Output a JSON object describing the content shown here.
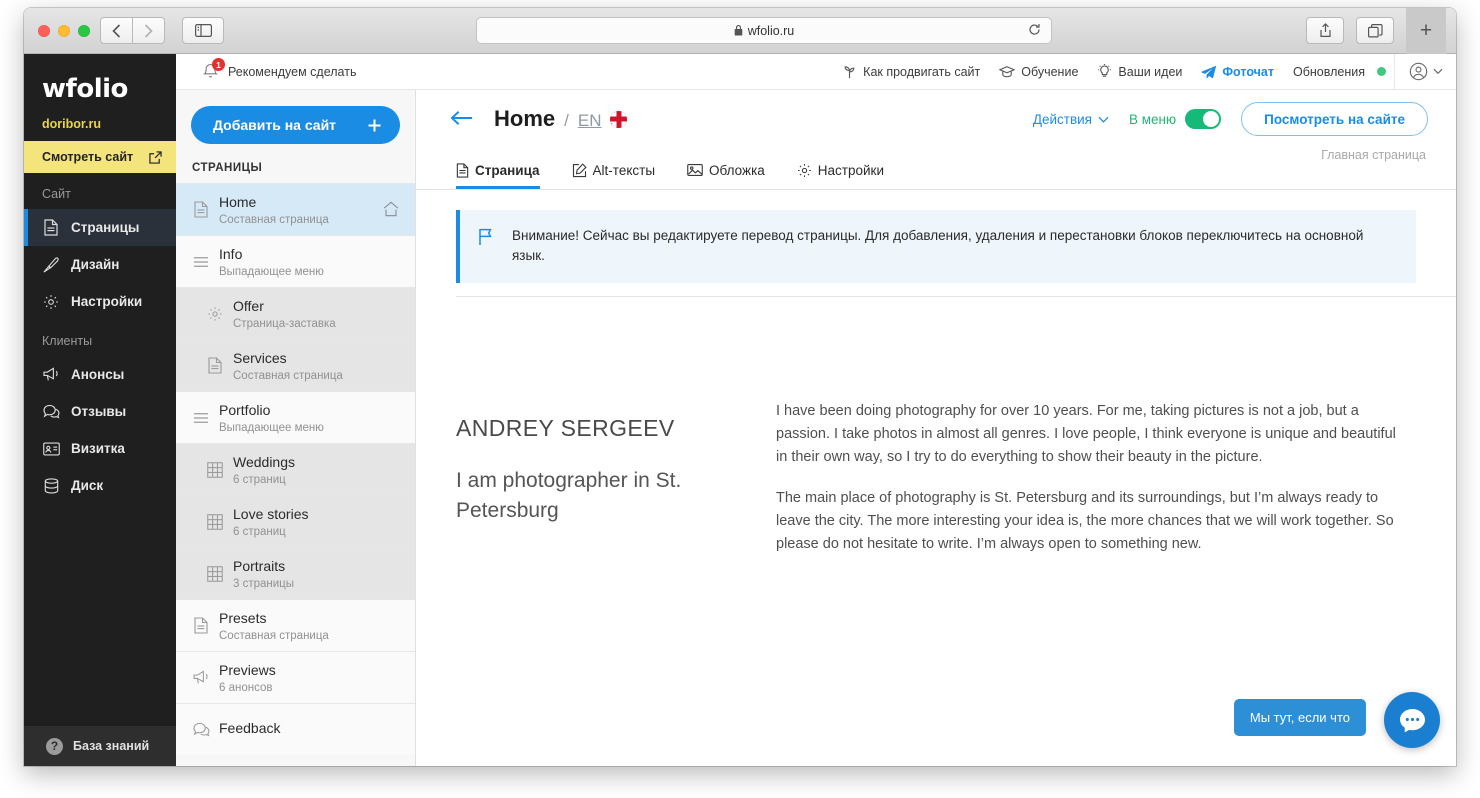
{
  "browser": {
    "url": "wfolio.ru",
    "lock_icon": "lock-icon",
    "reload_icon": "reload-icon",
    "back_icon": "chevron-left-icon",
    "forward_icon": "chevron-right-icon",
    "sidebar_icon": "sidebar-toggle-icon",
    "share_icon": "share-icon",
    "tabs_icon": "tab-overview-icon",
    "new_tab_icon": "plus-icon"
  },
  "sidebar": {
    "brand": "wfolio",
    "domain": "doribor.ru",
    "view_site": "Смотреть сайт",
    "view_site_icon": "external-link-icon",
    "groups": [
      {
        "title": "Сайт",
        "items": [
          {
            "label": "Страницы",
            "icon": "document-icon",
            "active": true
          },
          {
            "label": "Дизайн",
            "icon": "brush-icon",
            "active": false
          },
          {
            "label": "Настройки",
            "icon": "gear-icon",
            "active": false
          }
        ]
      },
      {
        "title": "Клиенты",
        "items": [
          {
            "label": "Анонсы",
            "icon": "megaphone-icon",
            "active": false
          },
          {
            "label": "Отзывы",
            "icon": "chat-icon",
            "active": false
          },
          {
            "label": "Визитка",
            "icon": "contact-card-icon",
            "active": false
          },
          {
            "label": "Диск",
            "icon": "database-icon",
            "active": false
          }
        ]
      }
    ],
    "knowledge_base": "База знаний",
    "knowledge_base_icon": "question-mark-icon"
  },
  "pages_panel": {
    "add_button": "Добавить на сайт",
    "add_button_icon": "plus-icon",
    "heading": "СТРАНИЦЫ",
    "items": [
      {
        "title": "Home",
        "subtitle": "Составная страница",
        "icon": "document-icon",
        "state": "selected",
        "indent": false,
        "right_icon": "home-icon"
      },
      {
        "title": "Info",
        "subtitle": "Выпадающее меню",
        "icon": "hamburger-icon",
        "state": "normal",
        "indent": false,
        "right_icon": ""
      },
      {
        "title": "Offer",
        "subtitle": "Страница-заставка",
        "icon": "gear-dotted-icon",
        "state": "shaded",
        "indent": true,
        "right_icon": ""
      },
      {
        "title": "Services",
        "subtitle": "Составная страница",
        "icon": "document-icon",
        "state": "shaded",
        "indent": true,
        "right_icon": ""
      },
      {
        "title": "Portfolio",
        "subtitle": "Выпадающее меню",
        "icon": "hamburger-icon",
        "state": "normal",
        "indent": false,
        "right_icon": ""
      },
      {
        "title": "Weddings",
        "subtitle": "6 страниц",
        "icon": "grid-icon",
        "state": "shaded",
        "indent": true,
        "right_icon": ""
      },
      {
        "title": "Love stories",
        "subtitle": "6 страниц",
        "icon": "grid-icon",
        "state": "shaded",
        "indent": true,
        "right_icon": ""
      },
      {
        "title": "Portraits",
        "subtitle": "3 страницы",
        "icon": "grid-icon",
        "state": "shaded",
        "indent": true,
        "right_icon": ""
      },
      {
        "title": "Presets",
        "subtitle": "Составная страница",
        "icon": "document-icon",
        "state": "normal",
        "indent": false,
        "right_icon": ""
      },
      {
        "title": "Previews",
        "subtitle": "6 анонсов",
        "icon": "megaphone-icon",
        "state": "normal",
        "indent": false,
        "right_icon": ""
      },
      {
        "title": "Feedback",
        "subtitle": "",
        "icon": "chat-icon",
        "state": "normal",
        "indent": false,
        "right_icon": ""
      }
    ]
  },
  "top_bar": {
    "notification_label": "Рекомендуем сделать",
    "notification_count": "1",
    "bell_icon": "bell-icon",
    "links": [
      {
        "label": "Как продвигать сайт",
        "icon": "sprout-icon",
        "accent": false,
        "dot": false
      },
      {
        "label": "Обучение",
        "icon": "graduation-cap-icon",
        "accent": false,
        "dot": false
      },
      {
        "label": "Ваши идеи",
        "icon": "lightbulb-icon",
        "accent": false,
        "dot": false
      },
      {
        "label": "Фоточат",
        "icon": "paper-plane-icon",
        "accent": true,
        "dot": false
      },
      {
        "label": "Обновления",
        "icon": "",
        "accent": false,
        "dot": true
      }
    ],
    "account_icon": "user-circle-icon",
    "account_chevron": "chevron-down-icon"
  },
  "page_header": {
    "back_icon": "arrow-left-icon",
    "title": "Home",
    "separator": "/",
    "lang_code": "EN",
    "lang_flag": "uk-flag-icon",
    "actions_label": "Действия",
    "actions_chevron": "chevron-down-icon",
    "menu_toggle_label": "В меню",
    "menu_toggle_state": "on",
    "view_site_button": "Посмотреть на сайте",
    "home_page_label": "Главная страница"
  },
  "tabs": [
    {
      "label": "Страница",
      "icon": "page-icon",
      "active": true
    },
    {
      "label": "Alt-тексты",
      "icon": "edit-square-icon",
      "active": false
    },
    {
      "label": "Обложка",
      "icon": "image-icon",
      "active": false
    },
    {
      "label": "Настройки",
      "icon": "gear-icon",
      "active": false
    }
  ],
  "notice": {
    "icon": "flag-icon",
    "text": "Внимание! Сейчас вы редактируете перевод страницы. Для добавления, удаления и перестановки блоков переключитесь на основной язык."
  },
  "content": {
    "name": "ANDREY SERGEEV",
    "tagline": "I am photographer in St. Petersburg",
    "paragraphs": [
      "I have been doing photography for over 10 years. For me, taking pictures is not a job, but a passion. I take photos in almost all genres. I love people, I think everyone is unique and beautiful in their own way, so I try to do everything to show their beauty in the picture.",
      "The main place of photography is St. Petersburg and its surroundings, but I’m always ready to leave the city. The more interesting your idea is, the more chances that we will work together. So please do not hesitate to write. I’m always open to something new."
    ]
  },
  "chat_widget": {
    "label": "Мы тут, если что",
    "icon": "chat-dots-icon"
  },
  "colors": {
    "accent_blue": "#1b8ce3",
    "sidebar_dark": "#1f1f1f",
    "yellow_bar": "#f4e47c",
    "toggle_green": "#17b978",
    "badge_red": "#e0322e",
    "selected_row": "#d6e9f7"
  }
}
